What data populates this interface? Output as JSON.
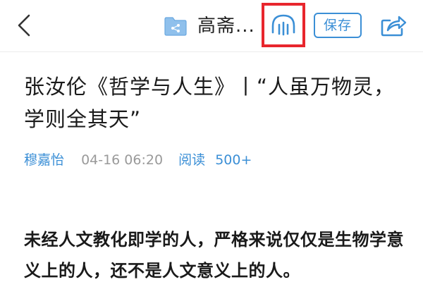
{
  "header": {
    "back_icon": "chevron-left-icon",
    "folder_icon": "shared-folder-icon",
    "channel_title": "高斋...",
    "listen_icon": "audio-listen-icon",
    "save_label": "保存",
    "share_icon": "share-icon",
    "highlight_color": "#e8262d",
    "accent_color": "#3b8fd6"
  },
  "article": {
    "title": "张汝伦《哲学与人生》丨“人虽万物灵，学则全其天”",
    "author": "穆嘉怡",
    "publish_time": "04-16 06:20",
    "read_label": "阅读",
    "read_count": "500+",
    "body": "未经人文教化即学的人，严格来说仅仅是生物学意义上的人，还不是人文意义上的人。"
  }
}
